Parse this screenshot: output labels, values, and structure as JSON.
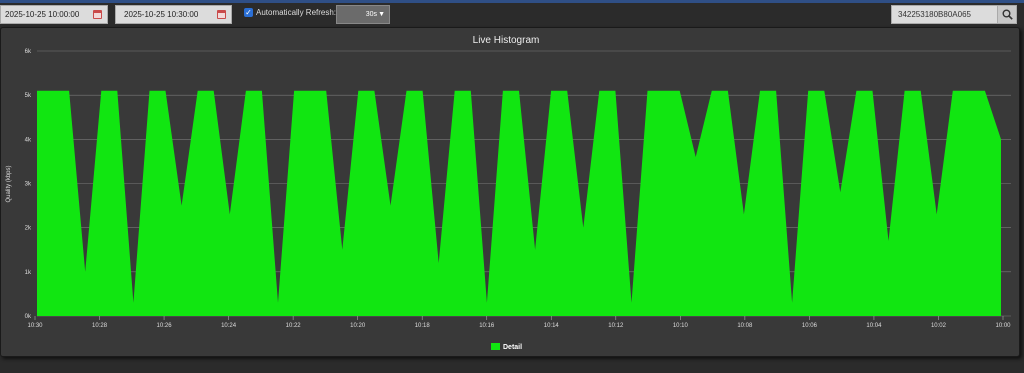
{
  "toolbar": {
    "start_time": "2025-10-25 10:00:00",
    "end_time": "2025-10-25 10:30:00",
    "auto_refresh_label": "Automatically Refresh:",
    "auto_refresh_checked": true,
    "refresh_interval": "30s",
    "search_value": "342253180B80A065"
  },
  "colors": {
    "series": "#11e611",
    "panel_bg": "#393939",
    "accent": "#2f4f86"
  },
  "chart_data": {
    "type": "area",
    "title": "Live Histogram",
    "ylabel": "Quality (kbps)",
    "xlabel": "",
    "ylim": [
      0,
      6000
    ],
    "yticks": [
      0,
      1000,
      2000,
      3000,
      4000,
      5000,
      6000
    ],
    "ytick_labels": [
      "0k",
      "1k",
      "2k",
      "3k",
      "4k",
      "5k",
      "6k"
    ],
    "xtick_labels": [
      "10:30",
      "10:28",
      "10:26",
      "10:24",
      "10:22",
      "10:20",
      "10:18",
      "10:16",
      "10:14",
      "10:12",
      "10:10",
      "10:08",
      "10:06",
      "10:04",
      "10:02",
      "10:00"
    ],
    "x_reversed": true,
    "grid": "horizontal",
    "legend": "bottom-center",
    "series": [
      {
        "name": "Detail",
        "x": [
          "10:30:00",
          "10:29:30",
          "10:29:00",
          "10:28:30",
          "10:28:00",
          "10:27:30",
          "10:27:00",
          "10:26:30",
          "10:26:00",
          "10:25:30",
          "10:25:00",
          "10:24:30",
          "10:24:00",
          "10:23:30",
          "10:23:00",
          "10:22:30",
          "10:22:00",
          "10:21:30",
          "10:21:00",
          "10:20:30",
          "10:20:00",
          "10:19:30",
          "10:19:00",
          "10:18:30",
          "10:18:00",
          "10:17:30",
          "10:17:00",
          "10:16:30",
          "10:16:00",
          "10:15:30",
          "10:15:00",
          "10:14:30",
          "10:14:00",
          "10:13:30",
          "10:13:00",
          "10:12:30",
          "10:12:00",
          "10:11:30",
          "10:11:00",
          "10:10:30",
          "10:10:00",
          "10:09:30",
          "10:09:00",
          "10:08:30",
          "10:08:00",
          "10:07:30",
          "10:07:00",
          "10:06:30",
          "10:06:00",
          "10:05:30",
          "10:05:00",
          "10:04:30",
          "10:04:00",
          "10:03:30",
          "10:03:00",
          "10:02:30",
          "10:02:00",
          "10:01:30",
          "10:01:00",
          "10:00:30",
          "10:00:00"
        ],
        "values": [
          5100,
          5100,
          5100,
          1000,
          5100,
          5100,
          300,
          5100,
          5100,
          2500,
          5100,
          5100,
          2300,
          5100,
          5100,
          300,
          5100,
          5100,
          5100,
          1500,
          5100,
          5100,
          2500,
          5100,
          5100,
          1200,
          5100,
          5100,
          300,
          5100,
          5100,
          1500,
          5100,
          5100,
          2000,
          5100,
          5100,
          300,
          5100,
          5100,
          5100,
          3600,
          5100,
          5100,
          2300,
          5100,
          5100,
          300,
          5100,
          5100,
          2800,
          5100,
          5100,
          1700,
          5100,
          5100,
          2300,
          5100,
          5100,
          5100,
          4000
        ]
      }
    ]
  }
}
